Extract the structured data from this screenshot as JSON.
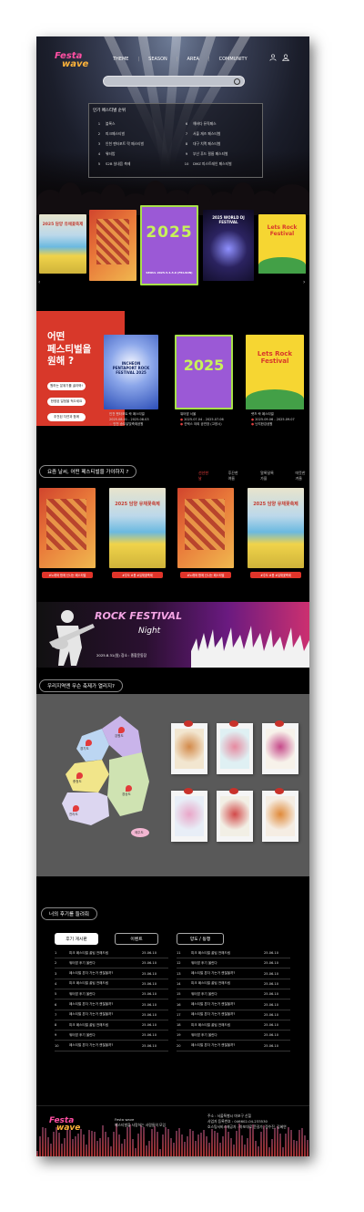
{
  "header": {
    "logo_line1": "Festa",
    "logo_line2": "wave",
    "nav": [
      "THEME",
      "SEASON",
      "AREA",
      "COMMUNITY"
    ],
    "icons": [
      "user-icon",
      "account-icon"
    ],
    "search": {
      "placeholder": "",
      "icon": "search-icon"
    }
  },
  "ranking": {
    "title": "인기 페스티벌 순위",
    "left": [
      {
        "n": "1",
        "name": "블록스"
      },
      {
        "n": "2",
        "name": "피크페스티벌"
      },
      {
        "n": "3",
        "name": "인천 펜타포트 락 페스티벌"
      },
      {
        "n": "4",
        "name": "워터밤"
      },
      {
        "n": "5",
        "name": "S2B 실내음 축제"
      }
    ],
    "right": [
      {
        "n": "6",
        "name": "해바다 뮤직페스"
      },
      {
        "n": "7",
        "name": "서울 재즈 페스티벌"
      },
      {
        "n": "8",
        "name": "대구 치맥 페스티벌"
      },
      {
        "n": "9",
        "name": "부산 푸드 필름 페스티벌"
      },
      {
        "n": "10",
        "name": "DMZ 피스트레인 페스티벌"
      }
    ]
  },
  "carousel": {
    "prev_icon": "chevron-left-icon",
    "next_icon": "chevron-right-icon",
    "posters": [
      {
        "title": "2025 담양 유채꽃축제",
        "style": "p-canola"
      },
      {
        "title": "",
        "style": "p-city"
      },
      {
        "title": "2025",
        "sub": "SEOUL 2025.5.4-5.6 (FRI-SUN)",
        "style": "p-2025"
      },
      {
        "title": "2025 WORLD DJ FESTIVAL",
        "style": "p-dj"
      },
      {
        "title": "Lets Rock Festival",
        "style": "p-rock"
      }
    ]
  },
  "recommend": {
    "title": "어떤\n페스티벌을\n원해 ?",
    "buttons": [
      "원하는 분위기를 골라봐!",
      "한정된 일정을 적으세요",
      "추천된 자연과 함께"
    ],
    "items": [
      {
        "poster_title": "INCHEON PENTAPORT ROCK FESTIVAL 2025",
        "name": "인천 펜타포트 락 페스티벌",
        "date": "2025.08.01 - 2025.08.03",
        "place": "인천 송도달빛축제공원"
      },
      {
        "poster_title": "2025",
        "name": "워터밤 서울",
        "date": "2025.07.04 - 2025.07.06",
        "place": "킨텍스 야외 공연장 (고양시)"
      },
      {
        "poster_title": "Lets Rock Festival",
        "name": "렛츠 락 페스티벌",
        "date": "2025.09.06 - 2025.09.07",
        "place": "난지한강공원"
      }
    ]
  },
  "weather_section": {
    "title": "요즘 날씨, 어떤 페스티벌을 가야하지 ?",
    "tabs": [
      "선선한 날",
      "후끈한 여름",
      "알록달록 가을",
      "따뜻한 겨울"
    ],
    "cards": [
      {
        "style": "p-city",
        "tag": "#노래와 함께 신나는 페스티벌",
        "title": ""
      },
      {
        "style": "p-canola",
        "tag": "#주도 #봄 #유채꽃축제",
        "title": "2025 담양 유채꽃축제"
      },
      {
        "style": "p-city",
        "tag": "#노래와 함께 신나는 페스티벌",
        "title": ""
      },
      {
        "style": "p-canola",
        "tag": "#주도 #봄 #유채꽃축제",
        "title": "2025 담양 유채꽃축제"
      }
    ]
  },
  "banner": {
    "title": "ROCK FESTIVAL",
    "subtitle": "Night",
    "date": "2025.8.31(일) 장소 : 종합운동장"
  },
  "region": {
    "title": "우리지역엔 무슨 축제가 열리지?",
    "labels": [
      "경기도",
      "강원도",
      "충청도",
      "경상도",
      "전라도",
      "제주도"
    ],
    "cards": [
      {
        "bg": "#f2e6d0",
        "accent": "#d38a4a"
      },
      {
        "bg": "#dff0f3",
        "accent": "#e68aa0"
      },
      {
        "bg": "#f7f2ea",
        "accent": "#c64a8a"
      },
      {
        "bg": "#e8eef7",
        "accent": "#e9a6c8"
      },
      {
        "bg": "#f2efe5",
        "accent": "#d24a4a"
      },
      {
        "bg": "#f5ede3",
        "accent": "#e08a3a"
      }
    ]
  },
  "reviews": {
    "title": "너의 후기를 들려줘",
    "tabs": [
      "후기 게시판",
      "이벤트",
      "양도 / 동행"
    ],
    "left": [
      {
        "n": "1",
        "title": "피크 페스티벌 꿀팁 전해드림",
        "date": "25.06.10"
      },
      {
        "n": "2",
        "title": "워터밤 후기 올린다",
        "date": "25.06.10"
      },
      {
        "n": "3",
        "title": "페스티벌 혼자 가는거 괜찮을까?",
        "date": "25.06.10"
      },
      {
        "n": "4",
        "title": "피크 페스티벌 꿀팁 전해드림",
        "date": "25.06.10"
      },
      {
        "n": "5",
        "title": "워터밤 후기 올린다",
        "date": "25.06.10"
      },
      {
        "n": "6",
        "title": "페스티벌 혼자 가는거 괜찮을까?",
        "date": "25.06.10"
      },
      {
        "n": "7",
        "title": "페스티벌 혼자 가는거 괜찮을까?",
        "date": "25.06.10"
      },
      {
        "n": "8",
        "title": "피크 페스티벌 꿀팁 전해드림",
        "date": "25.06.10"
      },
      {
        "n": "9",
        "title": "워터밤 후기 올린다",
        "date": "25.06.10"
      },
      {
        "n": "10",
        "title": "페스티벌 혼자 가는거 괜찮을까?",
        "date": "25.06.10"
      }
    ],
    "right": [
      {
        "n": "11",
        "title": "피크 페스티벌 꿀팁 전해드림",
        "date": "25.06.10"
      },
      {
        "n": "12",
        "title": "워터밤 후기 올린다",
        "date": "25.06.10"
      },
      {
        "n": "13",
        "title": "페스티벌 혼자 가는거 괜찮을까?",
        "date": "25.06.10"
      },
      {
        "n": "14",
        "title": "피크 페스티벌 꿀팁 전해드림",
        "date": "25.06.10"
      },
      {
        "n": "15",
        "title": "워터밤 후기 올린다",
        "date": "25.06.10"
      },
      {
        "n": "16",
        "title": "페스티벌 혼자 가는거 괜찮을까?",
        "date": "25.06.10"
      },
      {
        "n": "17",
        "title": "페스티벌 혼자 가는거 괜찮을까?",
        "date": "25.06.10"
      },
      {
        "n": "18",
        "title": "피크 페스티벌 꿀팁 전해드림",
        "date": "25.06.10"
      },
      {
        "n": "19",
        "title": "워터밤 후기 올린다",
        "date": "25.06.10"
      },
      {
        "n": "20",
        "title": "페스티벌 혼자 가는거 괜찮을까?",
        "date": "25.06.10"
      }
    ]
  },
  "footer": {
    "logo_line1": "Festa",
    "logo_line2": "wave",
    "brand": "Festa wave",
    "slogan": "페스티벌을 사랑하는 사람들의 모임",
    "address": "주소 : 서울특별시 마포구 신힐",
    "business": "사업자 등록번호 : 046602-04-233530",
    "contact": "호스팅서비스제공자 : 마포대로 문길가, 정수진, 김혜연"
  },
  "colors": {
    "accent": "#d8382a",
    "logo_pink": "#ff4fa3",
    "logo_orange": "#ffb43a"
  }
}
